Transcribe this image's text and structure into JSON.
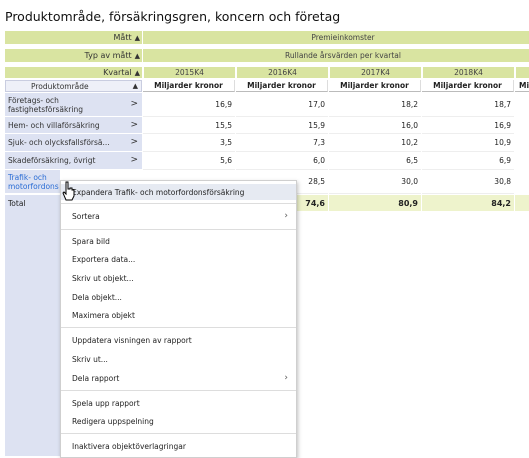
{
  "title": "Produktområde, försäkringsgren, koncern och företag",
  "header": {
    "matt_label": "Mått",
    "matt_value": "Premieinkomster",
    "typ_label": "Typ av mått",
    "typ_value": "Rullande årsvärden per kvartal",
    "kvartal_label": "Kvartal",
    "sort_arrow": "▲",
    "quarters": [
      "2015K4",
      "2016K4",
      "2017K4",
      "2018K4"
    ]
  },
  "columns": {
    "row_header": "Produktområde",
    "unit": "Miljarder kronor",
    "unit_cut": "Mil"
  },
  "rows": [
    {
      "label": "Företags- och fastighetsförsäkring",
      "values": [
        "16,9",
        "17,0",
        "18,2",
        "18,7"
      ]
    },
    {
      "label": "Hem- och villaförsäkring",
      "values": [
        "15,5",
        "15,9",
        "16,0",
        "16,9"
      ]
    },
    {
      "label": "Sjuk- och olycksfallsförsä...",
      "values": [
        "3,5",
        "7,3",
        "10,2",
        "10,9"
      ]
    },
    {
      "label": "Skadeförsäkring, övrigt",
      "values": [
        "5,6",
        "6,0",
        "6,5",
        "6,9"
      ]
    },
    {
      "label": "Trafik- och motorfordons",
      "values": [
        "",
        "28,5",
        "30,0",
        "30,8"
      ]
    }
  ],
  "total": {
    "label": "Total",
    "values": [
      "",
      "74,6",
      "80,9",
      "84,2"
    ]
  },
  "chevron": ">",
  "context_menu": {
    "expand": "Expandera Trafik- och motorfordonsförsäkring",
    "sort": "Sortera",
    "save_image": "Spara bild",
    "export": "Exportera data...",
    "print_object": "Skriv ut objekt...",
    "share_object": "Dela objekt...",
    "maximize": "Maximera objekt",
    "update_view": "Uppdatera visningen av rapport",
    "print": "Skriv ut...",
    "share_report": "Dela rapport",
    "play": "Spela upp rapport",
    "edit_play": "Redigera uppspelning",
    "disable_overlays": "Inaktivera objektöverlagringar",
    "submenu_arrow": "›"
  }
}
